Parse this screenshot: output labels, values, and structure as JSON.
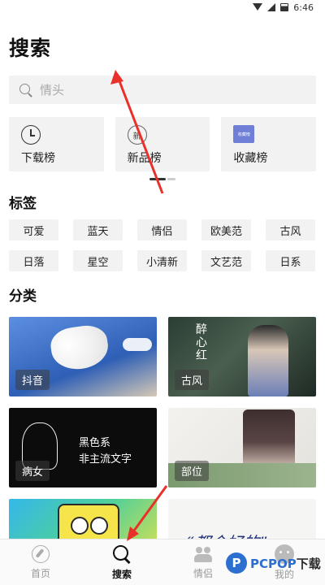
{
  "status_bar": {
    "time": "6:46"
  },
  "page": {
    "title": "搜索"
  },
  "search": {
    "placeholder": "情头"
  },
  "rankings": [
    {
      "label": "下载榜",
      "icon": "clock-icon"
    },
    {
      "label": "新品榜",
      "icon": "new-icon",
      "icon_text": "新"
    },
    {
      "label": "收藏榜",
      "icon": "favorite-icon",
      "icon_text": "收藏榜"
    }
  ],
  "tags": {
    "title": "标签",
    "items": [
      "可爱",
      "蓝天",
      "情侣",
      "欧美范",
      "古风",
      "日落",
      "星空",
      "小清新",
      "文艺范",
      "日系"
    ]
  },
  "categories": {
    "title": "分类",
    "items": [
      {
        "label": "抖音"
      },
      {
        "label": "古风",
        "overlay": "醉心红"
      },
      {
        "label": "病女",
        "overlay": "黑色系\n非主流文字"
      },
      {
        "label": "部位"
      },
      {
        "label": ""
      },
      {
        "label": "",
        "overlay": "“都会好的”"
      }
    ]
  },
  "bottom_nav": [
    {
      "label": "首页",
      "icon": "compass-icon",
      "active": false
    },
    {
      "label": "搜索",
      "icon": "search-icon",
      "active": true
    },
    {
      "label": "情侣",
      "icon": "couple-icon",
      "active": false
    },
    {
      "label": "我的",
      "icon": "face-icon",
      "active": false
    }
  ],
  "watermark": {
    "text_prefix": "PCPOP",
    "text_suffix": "下载",
    "badge": "P"
  },
  "colors": {
    "accent": "#111111",
    "arrow": "#e8312b",
    "watermark_blue": "#2c6fd1"
  }
}
